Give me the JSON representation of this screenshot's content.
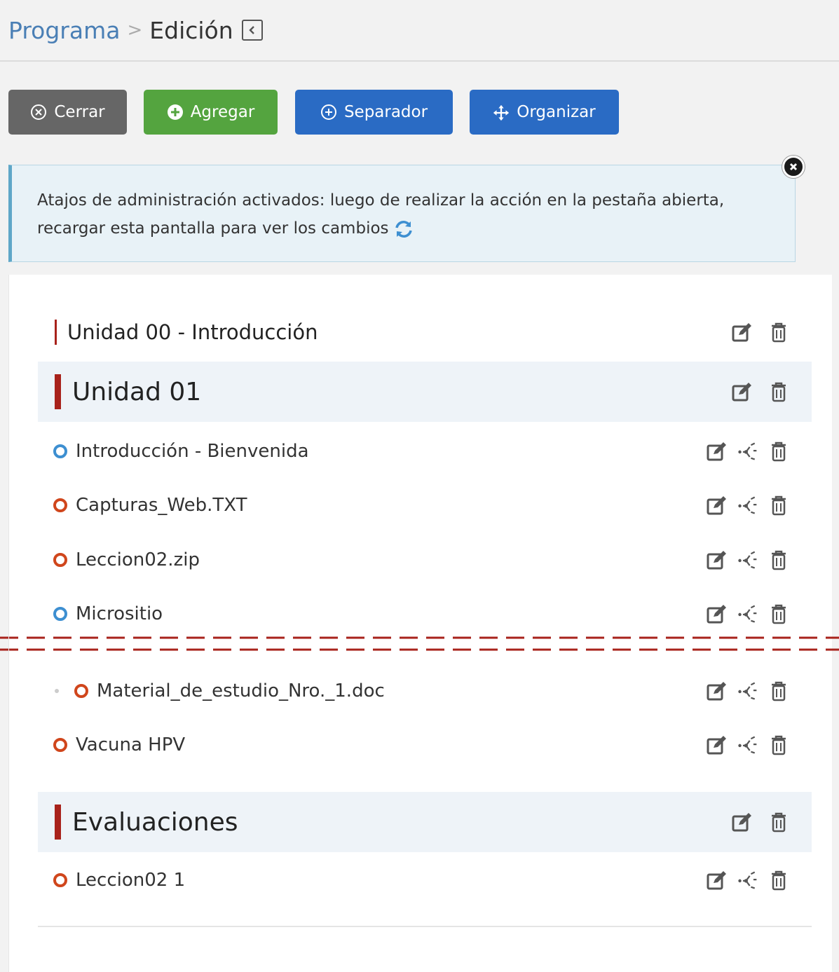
{
  "breadcrumb": {
    "parent": "Programa",
    "separator": ">",
    "current": "Edición"
  },
  "toolbar": {
    "cerrar": "Cerrar",
    "agregar": "Agregar",
    "separador": "Separador",
    "organizar": "Organizar"
  },
  "alert": {
    "text": "Atajos de administración activados: luego de realizar la acción en la pestaña abierta, recargar esta pantalla para ver los cambios"
  },
  "sections": [
    {
      "title": "Unidad 00 - Introducción"
    },
    {
      "title": "Unidad 01"
    },
    {
      "title": "Evaluaciones"
    }
  ],
  "items": [
    {
      "title": "Introducción - Bienvenida",
      "color": "blue"
    },
    {
      "title": "Capturas_Web.TXT",
      "color": "red"
    },
    {
      "title": "Leccion02.zip",
      "color": "red"
    },
    {
      "title": "Micrositio",
      "color": "blue"
    },
    {
      "title": "Material_de_estudio_Nro._1.doc",
      "color": "red",
      "nested": true
    },
    {
      "title": "Vacuna HPV",
      "color": "red"
    },
    {
      "title": "Leccion02 1",
      "color": "red"
    }
  ],
  "colors": {
    "accent_blue": "#2a6bc4",
    "accent_green": "#54a43f",
    "section_bar": "#a8221b",
    "ring_blue": "#3d8fd1",
    "ring_red": "#d0461c"
  }
}
